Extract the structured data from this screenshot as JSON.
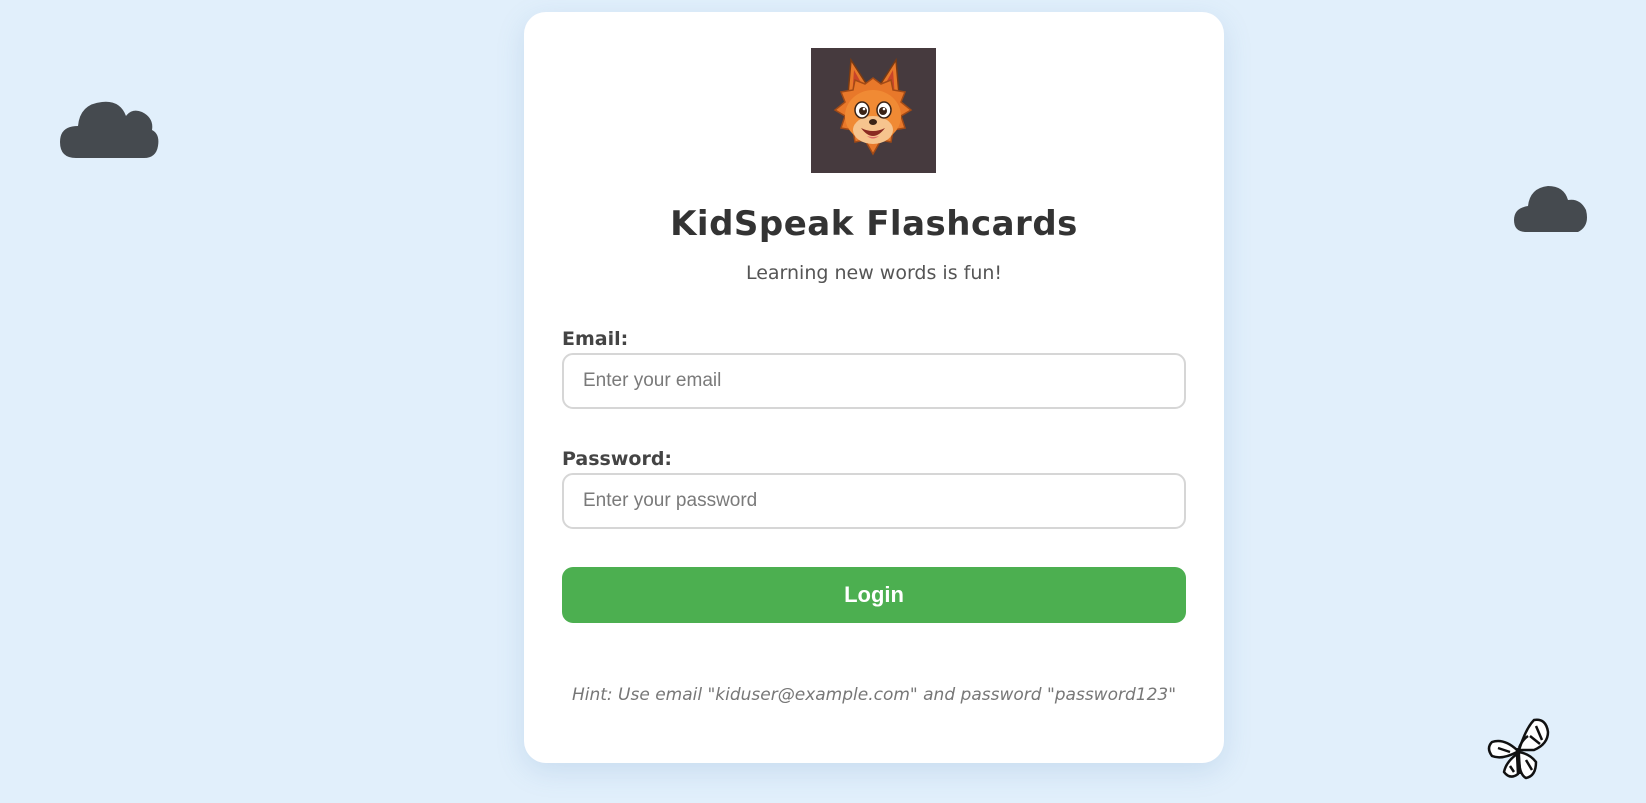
{
  "app": {
    "title": "KidSpeak Flashcards",
    "subtitle": "Learning new words is fun!"
  },
  "form": {
    "email_label": "Email:",
    "email_placeholder": "Enter your email",
    "email_value": "",
    "password_label": "Password:",
    "password_placeholder": "Enter your password",
    "password_value": "",
    "login_label": "Login"
  },
  "hint": "Hint: Use email \"kiduser@example.com\" and password \"password123\"",
  "decorations": {
    "cloud_icons": [
      "cloud-icon",
      "cloud-icon"
    ],
    "butterfly_icon": "butterfly-icon",
    "mascot": "fox-mascot-logo"
  },
  "colors": {
    "background": "#e1effb",
    "card": "#ffffff",
    "accent": "#4caf50",
    "cloud": "#454a4f",
    "mascot_bg": "#463a3e"
  }
}
